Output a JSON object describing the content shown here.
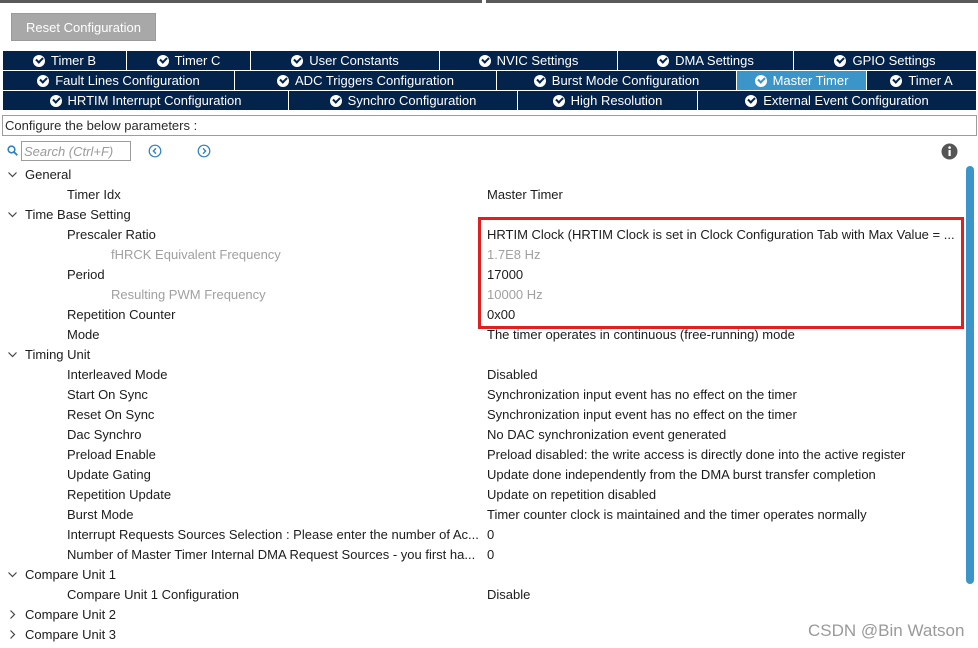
{
  "reset_button": {
    "label": "Reset Configuration"
  },
  "tabs": {
    "row1": [
      {
        "label": "Timer B",
        "active": false
      },
      {
        "label": "Timer C",
        "active": false
      },
      {
        "label": "User Constants",
        "active": false
      },
      {
        "label": "NVIC Settings",
        "active": false
      },
      {
        "label": "DMA Settings",
        "active": false
      },
      {
        "label": "GPIO Settings",
        "active": false
      }
    ],
    "row2": [
      {
        "label": "Fault Lines Configuration",
        "active": false
      },
      {
        "label": "ADC Triggers Configuration",
        "active": false
      },
      {
        "label": "Burst Mode Configuration",
        "active": false
      },
      {
        "label": "Master Timer",
        "active": true
      },
      {
        "label": "Timer A",
        "active": false
      }
    ],
    "row3": [
      {
        "label": "HRTIM Interrupt Configuration",
        "active": false
      },
      {
        "label": "Synchro Configuration",
        "active": false
      },
      {
        "label": "High Resolution",
        "active": false
      },
      {
        "label": "External Event Configuration",
        "active": false
      }
    ]
  },
  "configure_text": "Configure the below parameters :",
  "search": {
    "placeholder": "Search (Ctrl+F)"
  },
  "tree": {
    "general": {
      "label": "General",
      "timer_idx": {
        "name": "Timer Idx",
        "value": "Master Timer"
      }
    },
    "time_base": {
      "label": "Time Base Setting",
      "prescaler": {
        "name": "Prescaler Ratio",
        "value": "HRTIM Clock (HRTIM Clock is set in Clock Configuration Tab with Max Value = ..."
      },
      "fhrck": {
        "name": "fHRCK Equivalent Frequency",
        "value": "1.7E8 Hz"
      },
      "period": {
        "name": "Period",
        "value": "17000"
      },
      "pwm_freq": {
        "name": "Resulting PWM Frequency",
        "value": "10000 Hz"
      },
      "rep_counter": {
        "name": "Repetition Counter",
        "value": "0x00"
      },
      "mode": {
        "name": "Mode",
        "value": "The timer operates in continuous (free-running) mode"
      }
    },
    "timing_unit": {
      "label": "Timing Unit",
      "interleaved": {
        "name": "Interleaved Mode",
        "value": "Disabled"
      },
      "start_on_sync": {
        "name": "Start On Sync",
        "value": "Synchronization input event has no effect on the timer"
      },
      "reset_on_sync": {
        "name": "Reset On Sync",
        "value": "Synchronization input event has no effect on the timer"
      },
      "dac_synchro": {
        "name": "Dac Synchro",
        "value": "No DAC synchronization event generated"
      },
      "preload": {
        "name": "Preload Enable",
        "value": "Preload disabled: the write access is directly done into the active register"
      },
      "update_gating": {
        "name": "Update Gating",
        "value": "Update done independently from the DMA burst transfer completion"
      },
      "rep_update": {
        "name": "Repetition Update",
        "value": "Update on repetition disabled"
      },
      "burst_mode": {
        "name": "Burst Mode",
        "value": "Timer counter clock is maintained and the timer operates normally"
      },
      "irq_sources": {
        "name": "Interrupt Requests Sources Selection : Please enter the number of Ac...",
        "value": "0"
      },
      "dma_sources": {
        "name": "Number of Master Timer Internal DMA Request Sources  - you first ha...",
        "value": "0"
      }
    },
    "compare1": {
      "label": "Compare Unit 1",
      "config": {
        "name": "Compare Unit 1 Configuration",
        "value": "Disable"
      }
    },
    "compare2": {
      "label": "Compare Unit 2"
    },
    "compare3": {
      "label": "Compare Unit 3"
    }
  },
  "watermark": "CSDN @Bin Watson",
  "colors": {
    "tab_bg": "#03234b",
    "tab_active": "#3c95c8",
    "highlight": "#e02020",
    "scroll": "#3c95c8"
  }
}
